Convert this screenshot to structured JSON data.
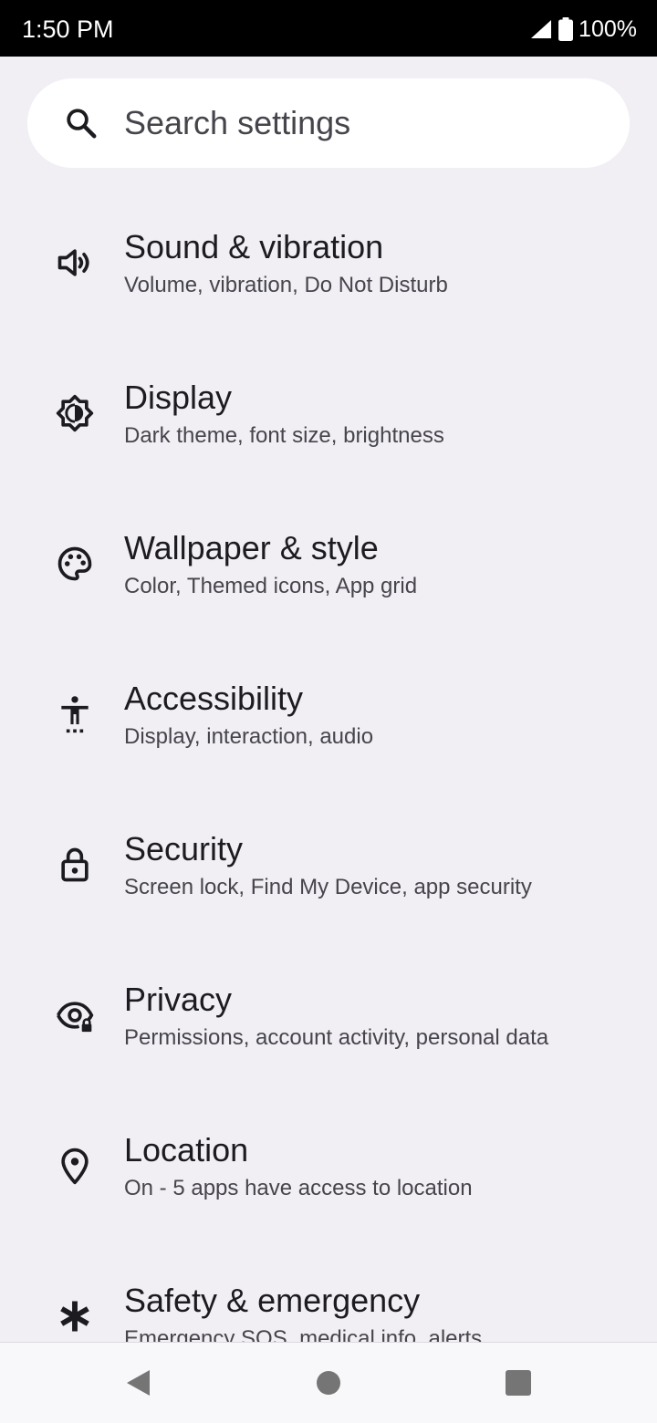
{
  "status_bar": {
    "time": "1:50 PM",
    "battery_percent": "100%",
    "icons": [
      "signal-icon",
      "battery-icon"
    ]
  },
  "search": {
    "placeholder": "Search settings",
    "icon": "search-icon"
  },
  "settings": {
    "items": [
      {
        "title": "Sound & vibration",
        "subtitle": "Volume, vibration, Do Not Disturb",
        "icon": "volume-icon"
      },
      {
        "title": "Display",
        "subtitle": "Dark theme, font size, brightness",
        "icon": "brightness-icon"
      },
      {
        "title": "Wallpaper & style",
        "subtitle": "Color, Themed icons, App grid",
        "icon": "palette-icon"
      },
      {
        "title": "Accessibility",
        "subtitle": "Display, interaction, audio",
        "icon": "accessibility-icon"
      },
      {
        "title": "Security",
        "subtitle": "Screen lock, Find My Device, app security",
        "icon": "lock-icon"
      },
      {
        "title": "Privacy",
        "subtitle": "Permissions, account activity, personal data",
        "icon": "privacy-eye-icon"
      },
      {
        "title": "Location",
        "subtitle": "On - 5 apps have access to location",
        "icon": "location-pin-icon"
      },
      {
        "title": "Safety & emergency",
        "subtitle": "Emergency SOS, medical info, alerts",
        "icon": "asterisk-icon"
      }
    ]
  },
  "nav": {
    "icons": [
      "back-icon",
      "home-icon",
      "recents-icon"
    ]
  }
}
